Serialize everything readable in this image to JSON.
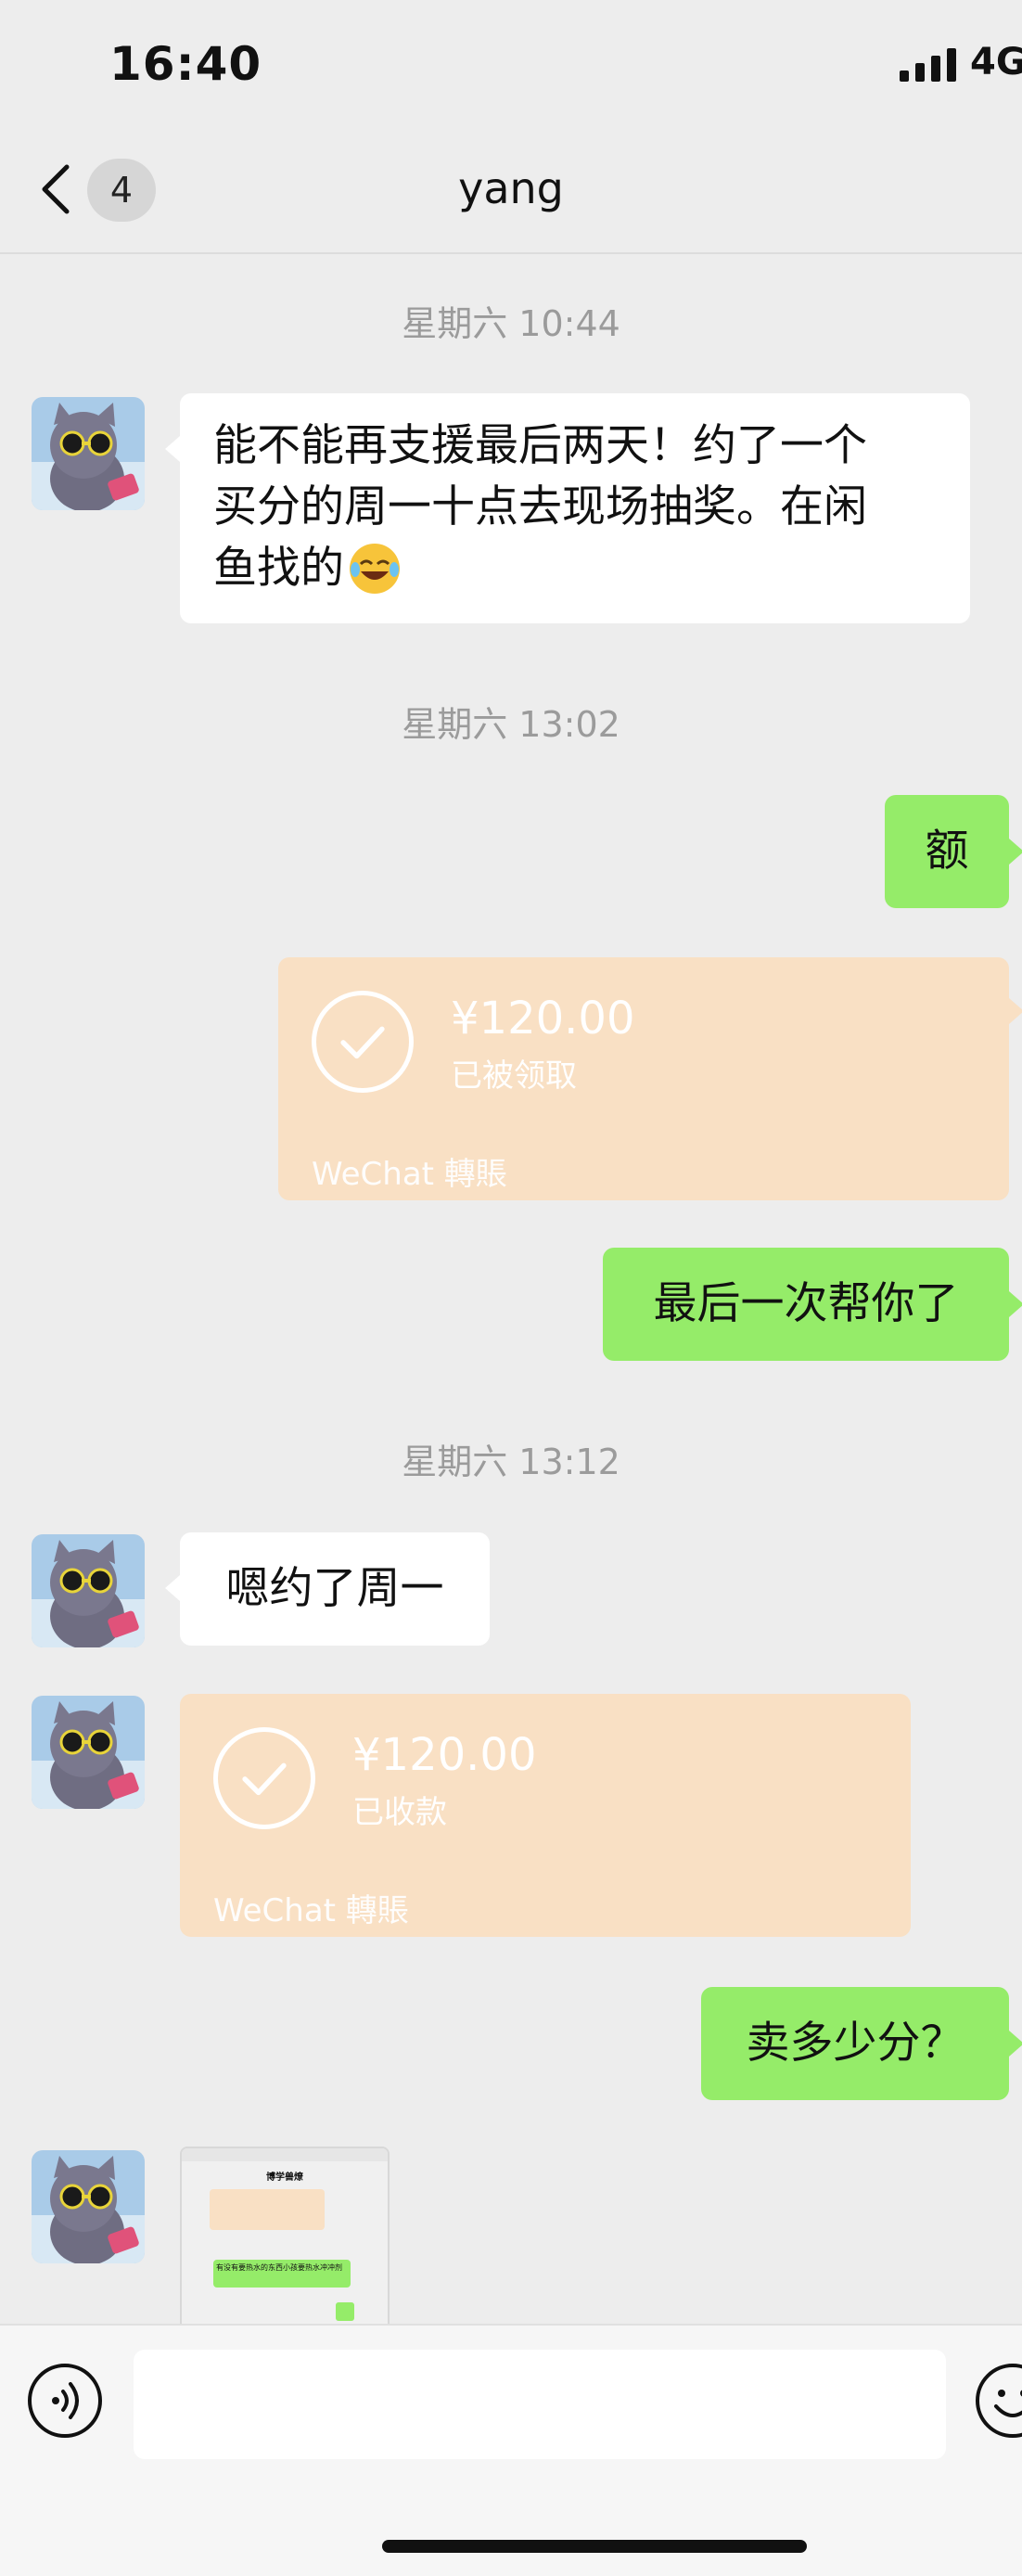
{
  "status_bar": {
    "time": "16:40",
    "network": "4G"
  },
  "nav": {
    "back_badge": "4",
    "title": "yang"
  },
  "messages": [
    {
      "type": "timestamp",
      "text": "星期六 10:44"
    },
    {
      "type": "text",
      "dir": "in",
      "lines": [
        "能不能再支援最后两天！约了一个",
        "买分的周一十点去现场抽奖。在闲",
        "鱼找的"
      ]
    },
    {
      "type": "timestamp",
      "text": "星期六 13:02"
    },
    {
      "type": "text",
      "dir": "out",
      "text": "额"
    },
    {
      "type": "transfer",
      "dir": "out",
      "amount": "¥120.00",
      "status": "已被领取",
      "brand": "WeChat 轉賬"
    },
    {
      "type": "text",
      "dir": "out",
      "text": "最后一次帮你了"
    },
    {
      "type": "timestamp",
      "text": "星期六 13:12"
    },
    {
      "type": "text",
      "dir": "in",
      "text": "嗯约了周一"
    },
    {
      "type": "transfer",
      "dir": "in",
      "amount": "¥120.00",
      "status": "已收款",
      "brand": "WeChat 轉賬"
    },
    {
      "type": "text",
      "dir": "out",
      "text": "卖多少分？"
    },
    {
      "type": "image",
      "dir": "in",
      "thumb_title": "博学兽燎",
      "thumb_msg": "有没有要热水的东西小孩要热水冲冲剂"
    }
  ],
  "input_bar": {
    "voice_icon": "voice-icon",
    "emoji_icon": "emoji-icon"
  },
  "colors": {
    "bg": "#ededed",
    "out_bubble": "#95ec69",
    "in_bubble": "#ffffff",
    "transfer": "#f9e0c4"
  }
}
